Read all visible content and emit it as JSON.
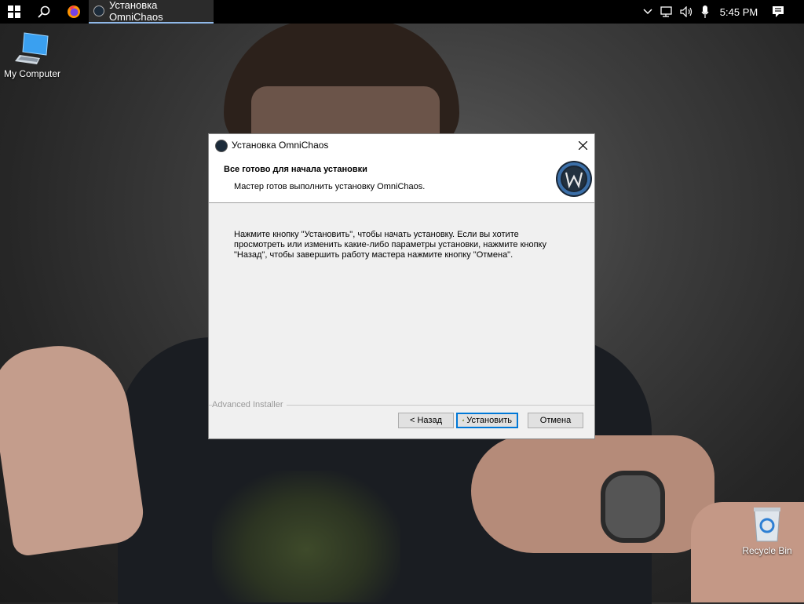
{
  "taskbar": {
    "active_task_label": "Установка OmniChaos",
    "clock": "5:45 PM"
  },
  "desktop": {
    "icons": [
      {
        "label": "My Computer"
      },
      {
        "label": "Recycle Bin"
      }
    ]
  },
  "dialog": {
    "title": "Установка OmniChaos",
    "header_title": "Все готово для начала установки",
    "header_subtitle": "Мастер готов выполнить установку OmniChaos.",
    "body_text": "Нажмите кнопку \"Установить\", чтобы начать установку. Если вы хотите просмотреть или изменить какие-либо параметры установки, нажмите кнопку \"Назад\", чтобы завершить работу мастера нажмите кнопку \"Отмена\".",
    "branding": "Advanced Installer",
    "buttons": {
      "back": "< Назад",
      "install": "Установить",
      "cancel": "Отмена"
    }
  },
  "colors": {
    "taskbar_bg": "#000000",
    "dialog_bg": "#f0f0f0",
    "accent": "#0078d7"
  }
}
